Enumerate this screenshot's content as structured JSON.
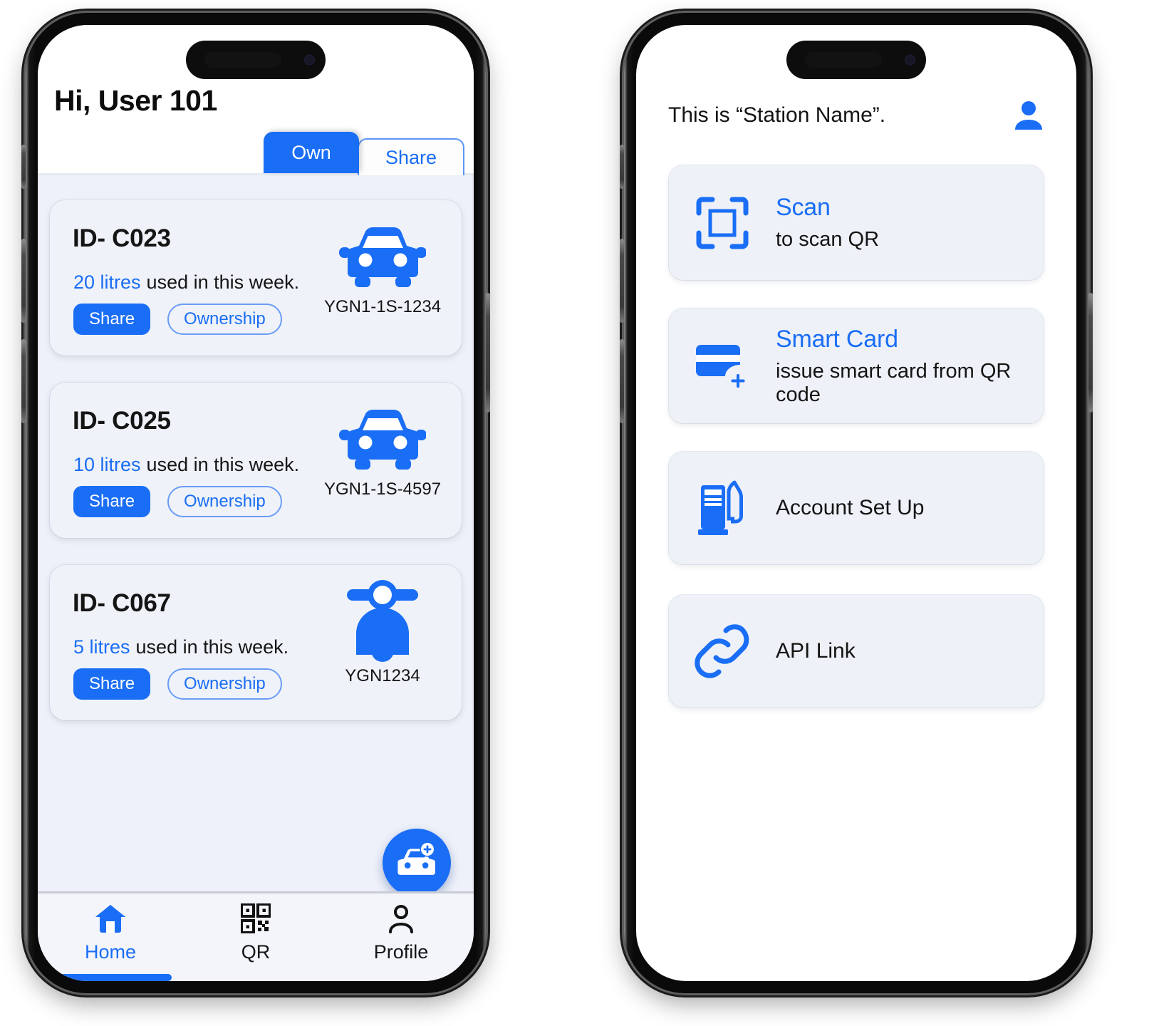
{
  "accent": "#1a6ef5",
  "left_phone": {
    "greeting": "Hi, User 101",
    "tabs": [
      {
        "label": "Own",
        "active": true
      },
      {
        "label": "Share",
        "active": false
      }
    ],
    "vehicles": [
      {
        "id_label": "ID- C023",
        "usage_amount": "20 litres",
        "usage_suffix": "used in this week.",
        "share_label": "Share",
        "ownership_label": "Ownership",
        "plate": "YGN1-1S-1234",
        "vehicle_type": "car"
      },
      {
        "id_label": "ID- C025",
        "usage_amount": "10 litres",
        "usage_suffix": "used in this week.",
        "share_label": "Share",
        "ownership_label": "Ownership",
        "plate": "YGN1-1S-4597",
        "vehicle_type": "car"
      },
      {
        "id_label": "ID- C067",
        "usage_amount": "5 litres",
        "usage_suffix": "used in this week.",
        "share_label": "Share",
        "ownership_label": "Ownership",
        "plate": "YGN1234",
        "vehicle_type": "scooter"
      }
    ],
    "fab": {
      "icon": "add-car-icon"
    },
    "bottom_nav": [
      {
        "label": "Home",
        "icon": "home-icon",
        "active": true
      },
      {
        "label": "QR",
        "icon": "qr-code-icon",
        "active": false
      },
      {
        "label": "Profile",
        "icon": "person-icon",
        "active": false
      }
    ]
  },
  "right_phone": {
    "station_title": "This is “Station Name”.",
    "account_icon": "person-filled-icon",
    "menu": [
      {
        "title": "Scan",
        "subtitle": "to scan QR",
        "icon": "scan-frame-icon"
      },
      {
        "title": "Smart Card",
        "subtitle": "issue smart card from QR code",
        "icon": "card-add-icon"
      },
      {
        "title": "Account Set Up",
        "subtitle": "",
        "icon": "fuel-pump-icon"
      },
      {
        "title": "API Link",
        "subtitle": "",
        "icon": "link-chain-icon"
      }
    ]
  }
}
